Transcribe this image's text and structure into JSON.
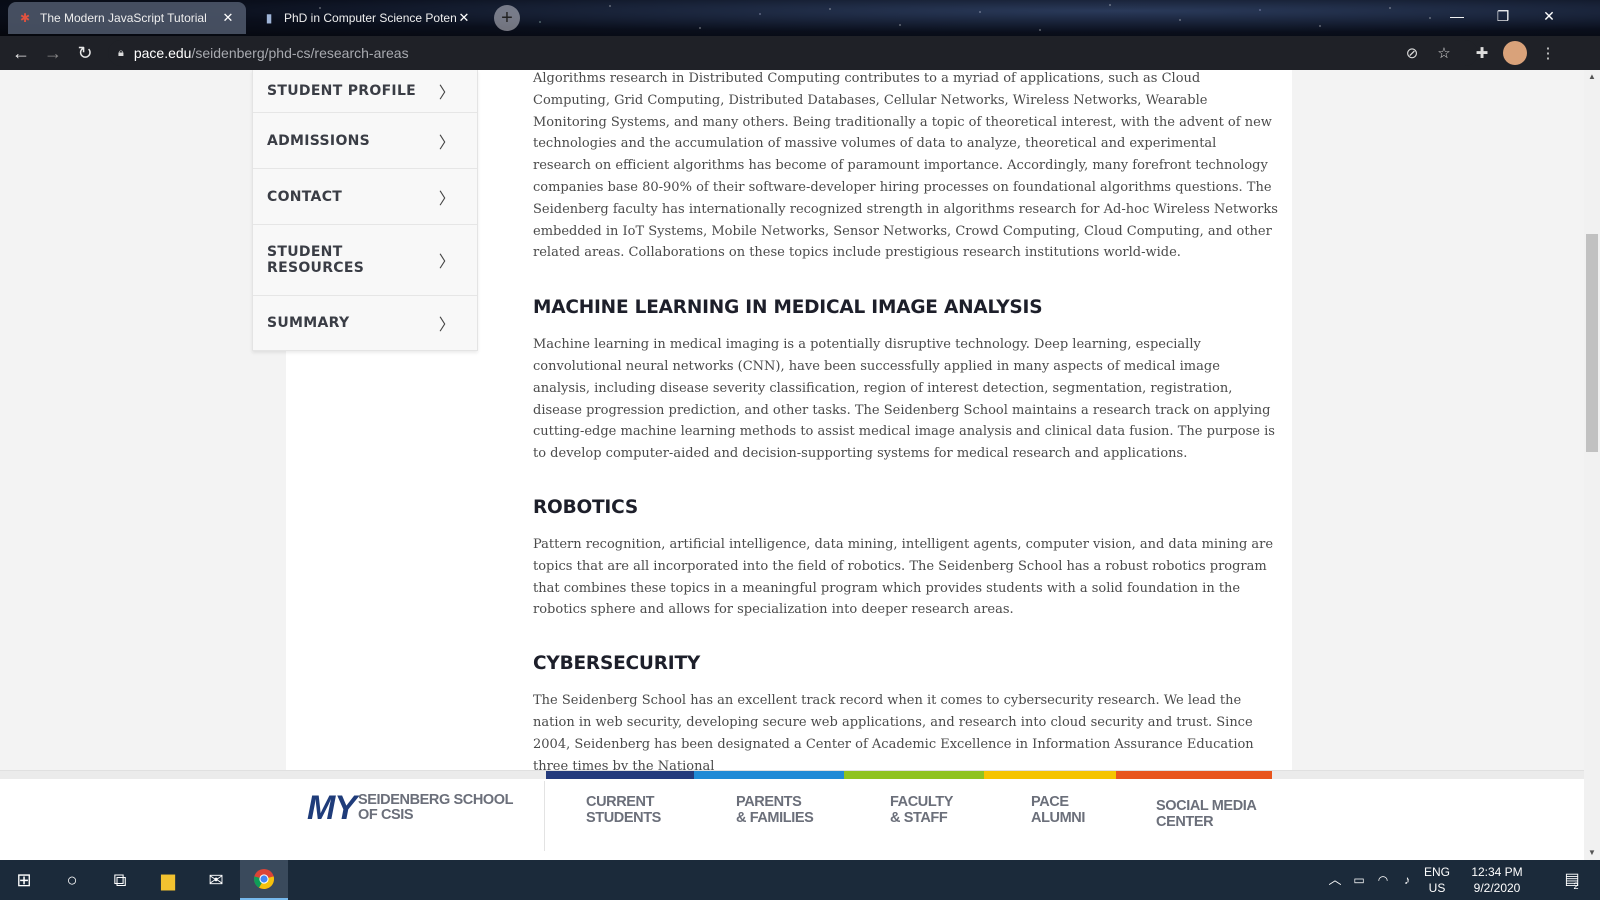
{
  "browser": {
    "tabs": [
      {
        "title": "The Modern JavaScript Tutorial",
        "favicon": "js-tutorial-icon",
        "active": true
      },
      {
        "title": "PhD in Computer Science Poten",
        "favicon": "pace-icon",
        "active": false
      }
    ],
    "new_tab_label": "+",
    "url_host": "pace.edu",
    "url_path": "/seidenberg/phd-cs/research-areas"
  },
  "sidebar": {
    "items": [
      {
        "label": "STUDENT PROFILE"
      },
      {
        "label": "ADMISSIONS"
      },
      {
        "label": "CONTACT"
      },
      {
        "label": "STUDENT RESOURCES"
      },
      {
        "label": "SUMMARY"
      }
    ]
  },
  "article": {
    "intro": "Algorithms research in Distributed Computing contributes to a myriad of applications, such as Cloud Computing, Grid Computing, Distributed Databases, Cellular Networks, Wireless Networks, Wearable Monitoring Systems, and many others. Being traditionally a topic of theoretical interest, with the advent of new technologies and the accumulation of massive volumes of data to analyze, theoretical and experimental research on efficient algorithms has become of paramount importance. Accordingly, many forefront technology companies base 80-90% of their software-developer hiring processes on foundational algorithms questions. The Seidenberg faculty has internationally recognized strength in algorithms research for Ad-hoc Wireless Networks embedded in IoT Systems, Mobile Networks, Sensor Networks, Crowd Computing, Cloud Computing, and other related areas. Collaborations on these topics include prestigious research institutions world-wide.",
    "sections": [
      {
        "heading": "MACHINE LEARNING IN MEDICAL IMAGE ANALYSIS",
        "body": "Machine learning in medical imaging is a potentially disruptive technology. Deep learning, especially convolutional neural networks (CNN), have been successfully applied in many aspects of medical image analysis, including disease severity classification, region of interest detection, segmentation, registration, disease progression prediction, and other tasks. The Seidenberg School maintains a research track on applying cutting-edge machine learning methods to assist medical image analysis and clinical data fusion. The purpose is to develop computer-aided and decision-supporting systems for medical research and applications."
      },
      {
        "heading": "ROBOTICS",
        "body": "Pattern recognition, artificial intelligence, data mining, intelligent agents, computer vision, and data mining are topics that are all incorporated into the field of robotics. The Seidenberg School has a robust robotics program that combines these topics in a meaningful program which provides students with a solid foundation in the robotics sphere and allows for specialization into deeper research areas."
      },
      {
        "heading": "CYBERSECURITY",
        "body": "The Seidenberg School has an excellent track record when it comes to cybersecurity research. We lead the nation in web security, developing secure web applications, and research into cloud security and trust. Since 2004, Seidenberg has been designated a Center of Academic Excellence in Information Assurance Education three times by the National"
      }
    ]
  },
  "footer": {
    "logo_my": "MY",
    "logo_line1": "SEIDENBERG SCHOOL",
    "logo_line2": "OF CSIS",
    "links": [
      {
        "line1": "CURRENT",
        "line2": "STUDENTS"
      },
      {
        "line1": "PARENTS",
        "line2": "& FAMILIES"
      },
      {
        "line1": "FACULTY",
        "line2": "& STAFF"
      },
      {
        "line1": "PACE",
        "line2": "ALUMNI"
      },
      {
        "line1": "SOCIAL MEDIA",
        "line2": "CENTER"
      }
    ],
    "stripe_colors": [
      "#233a7c",
      "#1f8ad6",
      "#8fc31f",
      "#f5c400",
      "#e8541c"
    ]
  },
  "taskbar": {
    "lang_line1": "ENG",
    "lang_line2": "US",
    "time": "12:34 PM",
    "date": "9/2/2020",
    "notification_count": "2"
  }
}
